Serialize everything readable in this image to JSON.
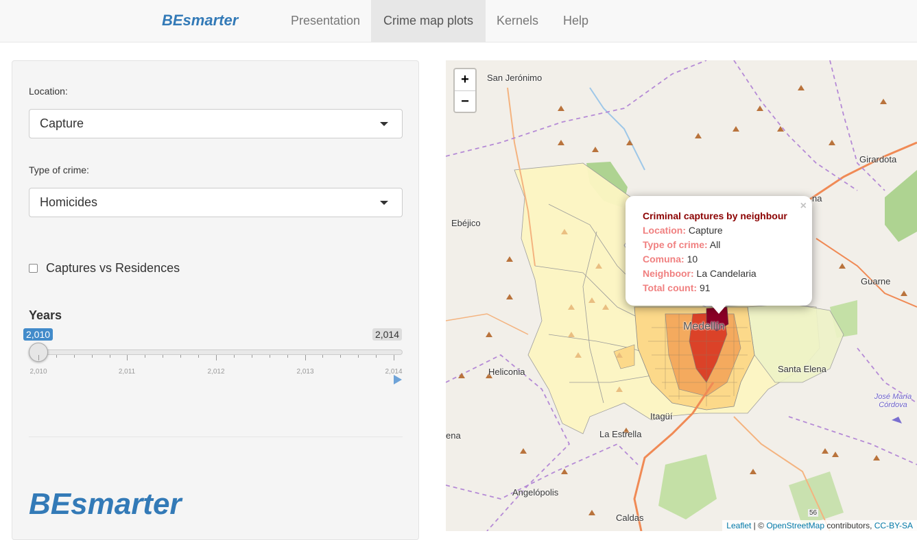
{
  "navbar": {
    "brand": "BEsmarter",
    "tabs": [
      {
        "label": "Presentation",
        "active": false
      },
      {
        "label": "Crime map plots",
        "active": true
      },
      {
        "label": "Kernels",
        "active": false
      },
      {
        "label": "Help",
        "active": false
      }
    ]
  },
  "sidebar": {
    "location": {
      "label": "Location:",
      "value": "Capture"
    },
    "crime_type": {
      "label": "Type of crime:",
      "value": "Homicides"
    },
    "captures_vs_residences": {
      "label": "Captures vs Residences",
      "checked": false
    },
    "years": {
      "label": "Years",
      "from": "2,010",
      "to": "2,014",
      "ticks": [
        "2,010",
        "2,011",
        "2,012",
        "2,013",
        "2,014"
      ]
    },
    "logo": "BEsmarter"
  },
  "map": {
    "zoom_in": "+",
    "zoom_out": "−",
    "places": [
      "San Jerónimo",
      "Ebéjico",
      "Girardota",
      "Guarne",
      "Heliconia",
      "Medellín",
      "Santa Elena",
      "Itagüí",
      "La Estrella",
      "Angelópolis",
      "Caldas",
      "José María Córdova",
      "ena",
      "na",
      "56"
    ],
    "popup": {
      "title": "Criminal captures by neighbour",
      "location_key": "Location:",
      "location_val": "Capture",
      "crime_key": "Type of crime:",
      "crime_val": "All",
      "comuna_key": "Comuna:",
      "comuna_val": "10",
      "neighbor_key": "Neighboor:",
      "neighbor_val": "La Candelaria",
      "total_key": "Total count:",
      "total_val": "91",
      "close": "×"
    },
    "attribution": {
      "leaflet": "Leaflet",
      "sep": "| ©",
      "osm": "OpenStreetMap",
      "contributors": "contributors,",
      "license": "CC-BY-SA"
    },
    "colors": {
      "choropleth_light": "#fdf6c3",
      "choropleth_mid": "#fcd98a",
      "choropleth_orange": "#f4a55a",
      "choropleth_red": "#d7301f",
      "choropleth_dark": "#8b0026",
      "forest": "#9ccc7b",
      "road": "#f08a55",
      "boundary": "#b58ad6"
    }
  }
}
